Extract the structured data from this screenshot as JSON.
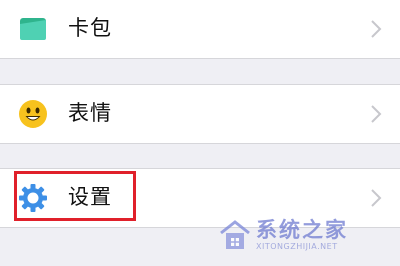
{
  "menu": {
    "items": [
      {
        "label": "卡包",
        "icon": "card-wallet-icon"
      },
      {
        "label": "表情",
        "icon": "emoji-smile-icon"
      },
      {
        "label": "设置",
        "icon": "gear-icon",
        "highlighted": true
      }
    ]
  },
  "watermark": {
    "text": "系统之家",
    "url": "XITONGZHIJIA.NET",
    "logo": "system-home-logo"
  },
  "colors": {
    "background": "#efeff4",
    "row": "#ffffff",
    "highlight": "#e0202a",
    "card_icon": "#36c3a4",
    "emoji_icon": "#f7c21e",
    "gear_icon": "#3d8fe6",
    "chevron": "#c7c7cc"
  }
}
